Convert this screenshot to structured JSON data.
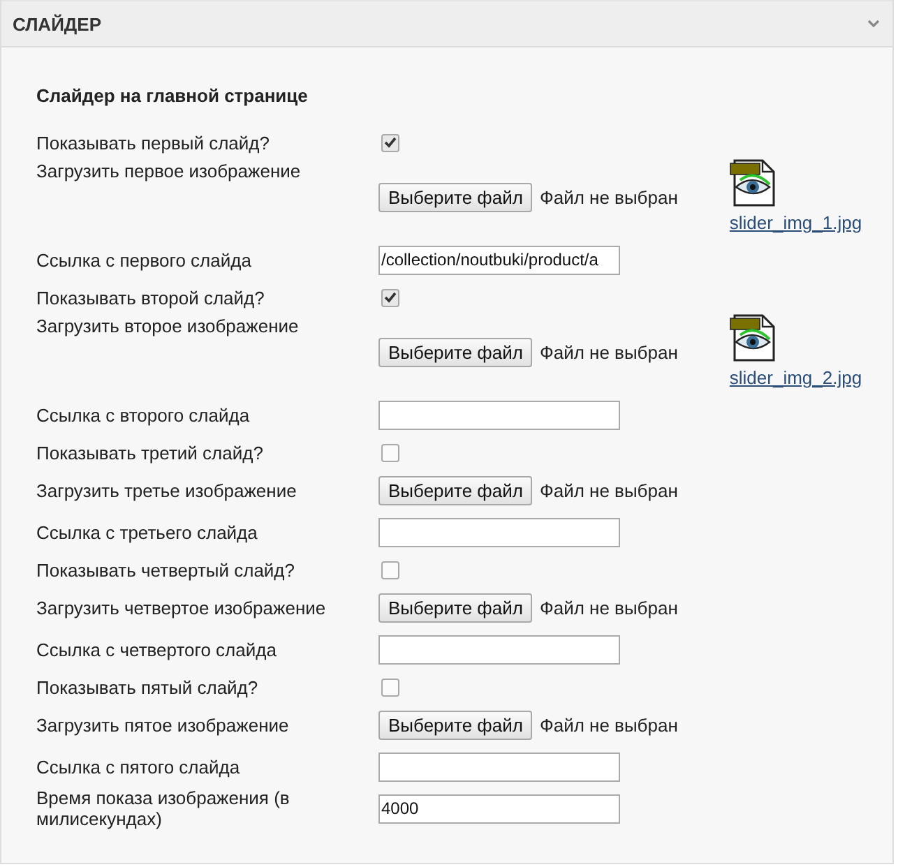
{
  "panel": {
    "title": "СЛАЙДЕР",
    "expanded": true
  },
  "section_title": "Слайдер на главной странице",
  "rows": [
    {
      "kind": "checkbox",
      "label": "Показывать первый слайд?",
      "checked": true
    },
    {
      "kind": "file",
      "label": "Загрузить первое изображение",
      "button": "Выберите файл",
      "status": "Файл не выбран",
      "image": {
        "filename": "slider_img_1.jpg"
      }
    },
    {
      "kind": "text",
      "label": "Ссылка с первого слайда",
      "value": "/collection/noutbuki/product/a"
    },
    {
      "kind": "checkbox",
      "label": "Показывать второй слайд?",
      "checked": true
    },
    {
      "kind": "file",
      "label": "Загрузить второе изображение",
      "button": "Выберите файл",
      "status": "Файл не выбран",
      "image": {
        "filename": "slider_img_2.jpg"
      }
    },
    {
      "kind": "text",
      "label": "Ссылка с второго слайда"
    },
    {
      "kind": "checkbox",
      "label": "Показывать третий слайд?",
      "checked": false
    },
    {
      "kind": "file",
      "label": "Загрузить третье изображение",
      "button": "Выберите файл",
      "status": "Файл не выбран"
    },
    {
      "kind": "text",
      "label": "Ссылка с третьего слайда"
    },
    {
      "kind": "checkbox",
      "label": "Показывать четвертый слайд?",
      "checked": false
    },
    {
      "kind": "file",
      "label": "Загрузить четвертое изображение",
      "button": "Выберите файл",
      "status": "Файл не выбран"
    },
    {
      "kind": "text",
      "label": "Ссылка с четвертого слайда"
    },
    {
      "kind": "checkbox",
      "label": "Показывать пятый слайд?",
      "checked": false
    },
    {
      "kind": "file",
      "label": "Загрузить пятое изображение",
      "button": "Выберите файл",
      "status": "Файл не выбран"
    },
    {
      "kind": "text",
      "label": "Ссылка с пятого слайда"
    },
    {
      "kind": "text",
      "label": "Время показа изображения (в милисекундах)",
      "value": "4000"
    }
  ]
}
